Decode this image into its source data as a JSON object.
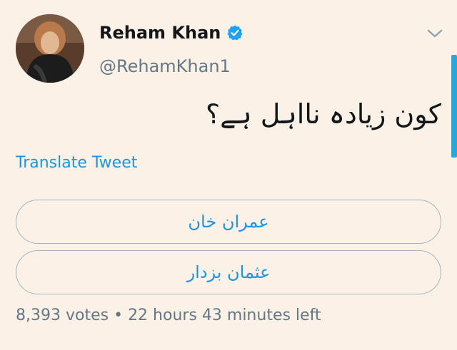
{
  "user": {
    "display_name": "Reham Khan",
    "handle": "@RehamKhan1",
    "verified": true
  },
  "icons": {
    "verified": "verified-badge-icon",
    "menu": "chevron-down-icon"
  },
  "tweet": {
    "text": "کون زیادہ نااہل ہے؟",
    "translate_label": "Translate Tweet"
  },
  "poll": {
    "options": [
      {
        "label": "عمران خان"
      },
      {
        "label": "عثمان بزدار"
      }
    ],
    "votes": "8,393 votes",
    "separator": "•",
    "time_left": "22 hours 43 minutes left"
  },
  "colors": {
    "background": "#fcf1e6",
    "accent": "#1b95e0",
    "secondary_text": "#657786",
    "scrollbar": "#29a8d8"
  }
}
